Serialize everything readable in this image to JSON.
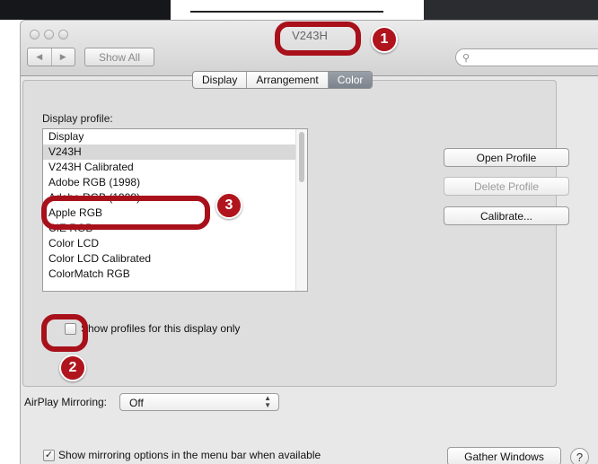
{
  "window": {
    "title": "V243H",
    "nav_back": "◀",
    "nav_forward": "▶",
    "show_all": "Show All",
    "search_placeholder": "",
    "search_icon": "magnifier-icon"
  },
  "tabs": [
    {
      "label": "Display",
      "active": false
    },
    {
      "label": "Arrangement",
      "active": false
    },
    {
      "label": "Color",
      "active": true
    }
  ],
  "color_pane": {
    "profile_label": "Display profile:",
    "profiles": [
      "Display",
      "V243H",
      "V243H Calibrated",
      "Adobe RGB (1998)",
      "Adobe RGB (1998)",
      "Apple RGB",
      "CIE RGB",
      "Color LCD",
      "Color LCD Calibrated",
      "ColorMatch RGB"
    ],
    "selected_index": 1,
    "buttons": {
      "open_profile": "Open Profile",
      "delete_profile": "Delete Profile",
      "calibrate": "Calibrate..."
    },
    "show_profiles_checkbox": {
      "label": "Show profiles for this display only",
      "checked": false
    }
  },
  "airplay": {
    "label": "AirPlay Mirroring:",
    "value": "Off"
  },
  "mirroring_checkbox": {
    "label": "Show mirroring options in the menu bar when available",
    "checked": true,
    "mark": "✓"
  },
  "gather_windows": "Gather Windows",
  "help": "?",
  "annotations": [
    {
      "number": "1",
      "color": "#b0141d"
    },
    {
      "number": "2",
      "color": "#b0141d"
    },
    {
      "number": "3",
      "color": "#b0141d"
    }
  ]
}
